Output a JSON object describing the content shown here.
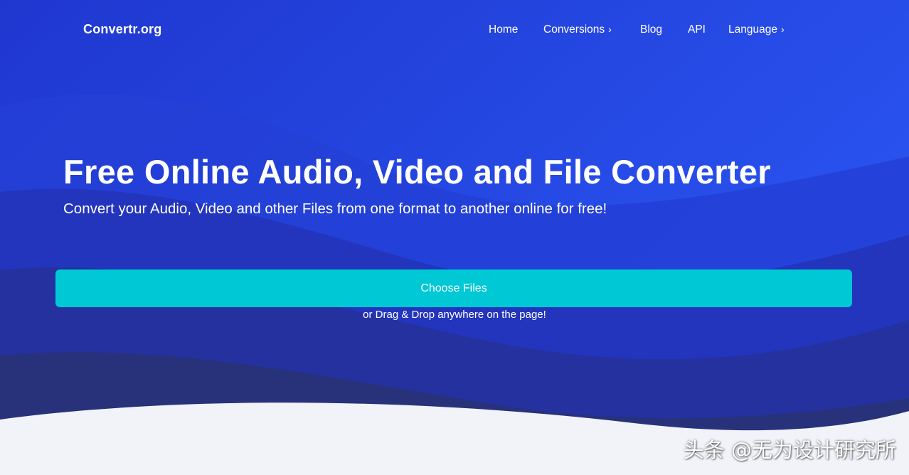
{
  "brand": {
    "name": "Convertr.org"
  },
  "nav": {
    "items": [
      {
        "label": "Home",
        "has_chevron": false
      },
      {
        "label": "Conversions",
        "has_chevron": true
      },
      {
        "label": "Blog",
        "has_chevron": false
      },
      {
        "label": "API",
        "has_chevron": false
      },
      {
        "label": "Language",
        "has_chevron": true
      }
    ],
    "chevron_glyph": "›"
  },
  "hero": {
    "title": "Free Online Audio, Video and File Converter",
    "subtitle": "Convert your Audio, Video and other Files from one format to another online for free!"
  },
  "upload": {
    "button_label": "Choose Files",
    "drag_note": "or Drag & Drop anywhere on the page!"
  },
  "watermark": {
    "text": "头条 @无为设计研究所"
  },
  "colors": {
    "hero_blue": "#2244dd",
    "wave_dark": "#28327a",
    "button_teal": "#00c8d4",
    "footer_bg": "#f1f3f9",
    "text_white": "#ffffff"
  },
  "icons": {
    "chevron": "chevron-right-icon"
  }
}
